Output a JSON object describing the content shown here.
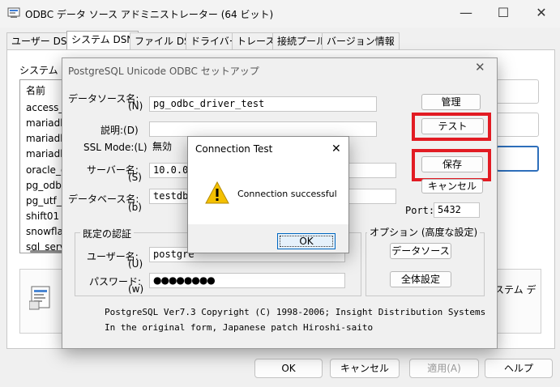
{
  "window": {
    "title": "ODBC データ ソース アドミニストレーター (64 ビット)",
    "icon": "odbc-app-icon"
  },
  "tabs": [
    "ユーザー DSN",
    "システム DSN",
    "ファイル DSN",
    "ドライバー",
    "トレース",
    "接続プール",
    "バージョン情報"
  ],
  "active_tab": "システム DSN",
  "system_dsn": {
    "label": "システム デ",
    "list_header": "名前",
    "list_items": [
      "access_t",
      "mariadb",
      "mariadb",
      "mariadb",
      "oracle_o",
      "pg_odbc",
      "pg_utf_t",
      "shift01",
      "snowflak",
      "sql_serv"
    ],
    "info_text": "ステム デ"
  },
  "bottom_buttons": {
    "ok": "OK",
    "cancel": "キャンセル",
    "apply": "適用(A)",
    "help": "ヘルプ"
  },
  "setup": {
    "title": "PostgreSQL Unicode ODBC セットアップ",
    "close": "✕",
    "datasource_label": "データソース名:",
    "datasource_key": "(N)",
    "datasource_value": "pg_odbc_driver_test",
    "description_label": "説明:(D)",
    "description_value": "",
    "sslmode_label": "SSL Mode:(L)",
    "sslmode_value": "無効",
    "server_label": "サーバー名:",
    "server_key": "(S)",
    "server_value": "10.0.0.",
    "database_label": "データベース名:",
    "database_key": "(b)",
    "database_value": "testdb1",
    "port_label": "Port:",
    "port_value": "5432",
    "manage_button": "管理",
    "test_button": "テスト",
    "save_button": "保存",
    "cancel_button": "キャンセル",
    "auth_group": "既定の認証",
    "user_label": "ユーザー名:",
    "user_key": "(U)",
    "user_value": "postgre",
    "password_label": "パスワード:",
    "password_key": "(w)",
    "password_value": "●●●●●●●●",
    "options_group": "オプション (高度な設定)",
    "datasource_button": "データソース",
    "global_button": "全体設定",
    "footer_line1": "PostgreSQL Ver7.3  Copyright (C) 1998-2006; Insight Distribution Systems",
    "footer_line2": "In the original form, Japanese patch Hiroshi-saito",
    "highlight_color": "#e21b23"
  },
  "conn_test": {
    "title": "Connection Test",
    "close": "✕",
    "message": "Connection successful",
    "ok": "OK",
    "icon": "warning-icon"
  }
}
